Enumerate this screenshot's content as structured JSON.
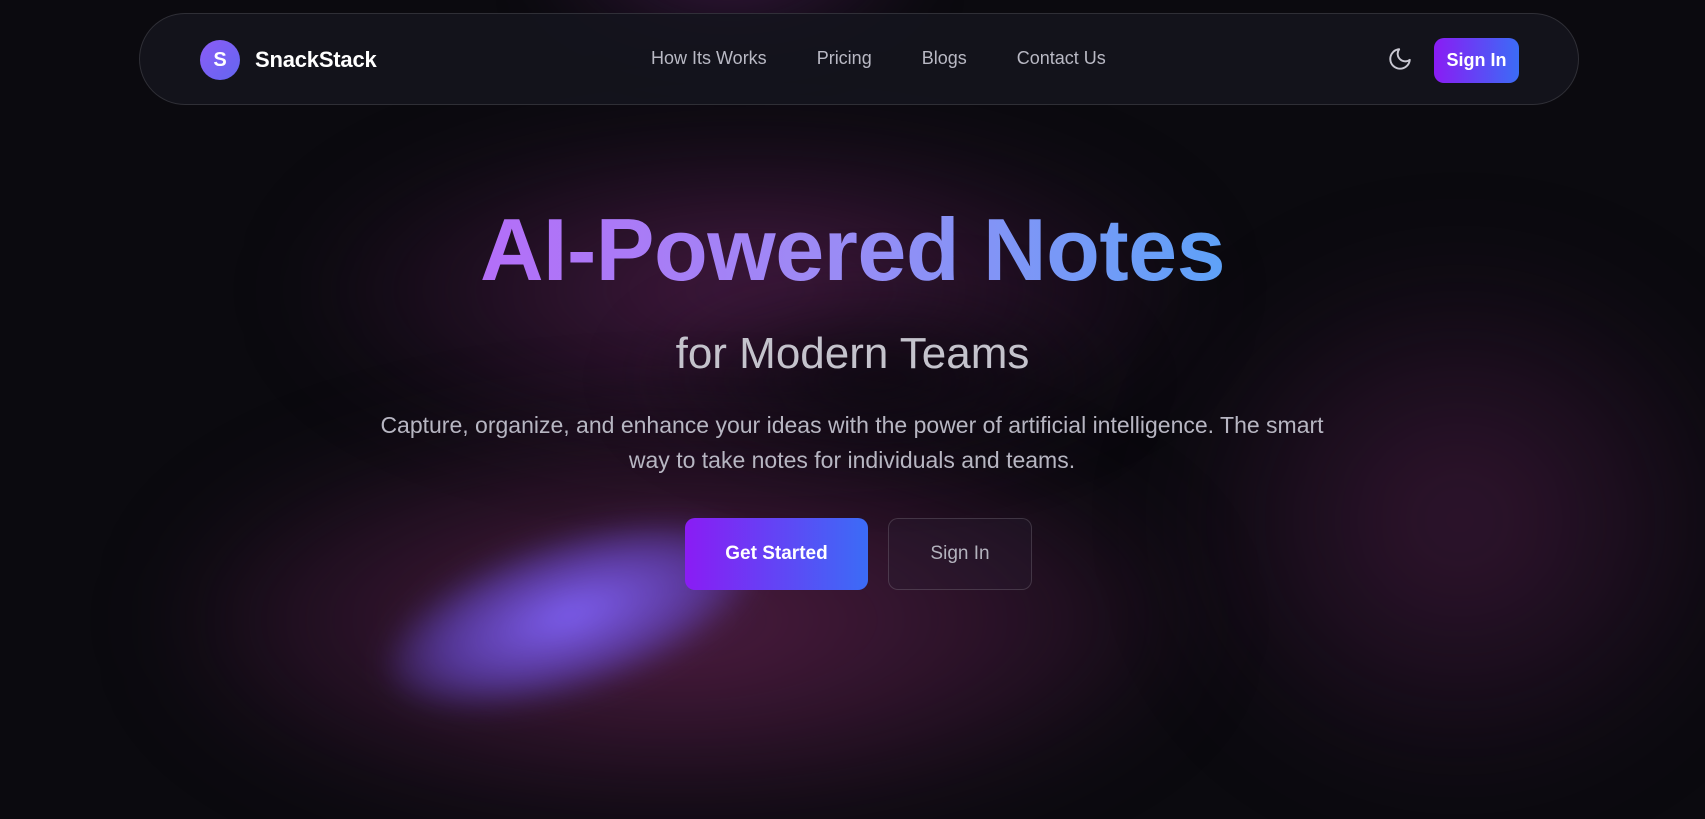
{
  "app": {
    "brand_initial": "S",
    "brand_name": "SnackStack"
  },
  "nav": {
    "links": [
      {
        "label": "How Its Works"
      },
      {
        "label": "Pricing"
      },
      {
        "label": "Blogs"
      },
      {
        "label": "Contact Us"
      }
    ],
    "theme_toggle_icon": "moon-icon",
    "signin_label": "Sign In"
  },
  "hero": {
    "headline": "AI-Powered Notes",
    "subheadline": "for Modern Teams",
    "description": "Capture, organize, and enhance your ideas with the power of artificial intelligence. The smart way to take notes for individuals and teams.",
    "primary_cta": "Get Started",
    "secondary_cta": "Sign In"
  },
  "colors": {
    "accent_start": "#8a1cf4",
    "accent_end": "#3b6cf6",
    "background": "#0b0a0f"
  }
}
